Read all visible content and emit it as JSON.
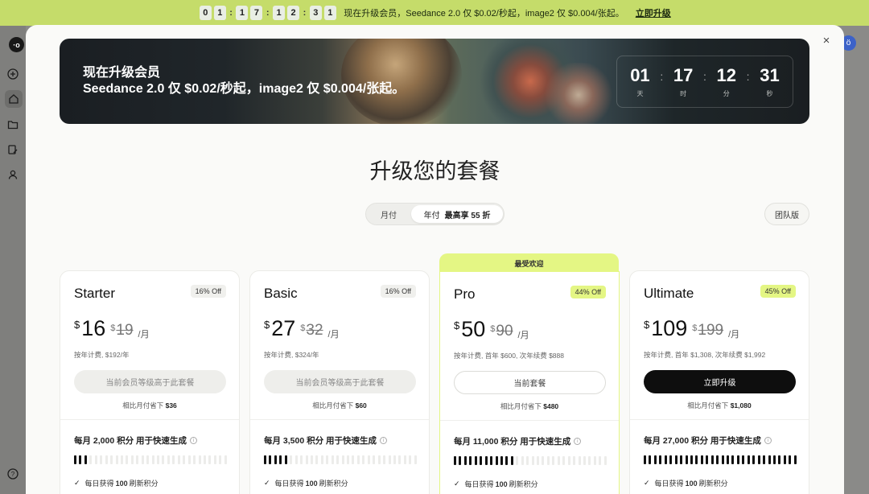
{
  "promo_bar": {
    "countdown_digits": [
      "0",
      "1",
      "1",
      "7",
      "1",
      "2",
      "3",
      "1"
    ],
    "message": "现在升级会员，Seedance 2.0 仅 $0.02/秒起，image2 仅 $0.004/张起。",
    "cta": "立即升级",
    "bg_color": "#c5dc6a"
  },
  "rail": {
    "logo": "·o",
    "icons": [
      "plus-circle-icon",
      "home-icon",
      "folder-icon",
      "edit-document-icon",
      "user-icon",
      "help-icon"
    ],
    "help_glyph": "?",
    "avatar_glyph": "ö"
  },
  "modal": {
    "close_glyph": "×",
    "banner": {
      "title": "现在升级会员",
      "subtitle": "Seedance 2.0 仅 $0.02/秒起，image2 仅 $0.004/张起。",
      "countdown": [
        {
          "value": "01",
          "label": "天"
        },
        {
          "value": "17",
          "label": "时"
        },
        {
          "value": "12",
          "label": "分"
        },
        {
          "value": "31",
          "label": "秒"
        }
      ]
    },
    "title": "升级您的套餐",
    "billing_toggle": {
      "monthly": "月付",
      "yearly": "年付",
      "yearly_discount": "最高享 55 折",
      "selected": "yearly"
    },
    "team_button": "团队版",
    "popular_tag": "最受欢迎",
    "plans": [
      {
        "name": "Starter",
        "badge": "16% Off",
        "currency": "$",
        "price": "16",
        "old_price": "19",
        "per": "/月",
        "billing_note": "按年计费, $192/年",
        "button": "当前会员等级高于此套餐",
        "button_style": "disabled",
        "savings_prefix": "相比月付省下",
        "savings": "$36",
        "credits": "每月 2,000 积分 用于快速生成",
        "credit_level": 3,
        "feature_prefix": "每日获得",
        "feature_value": "100",
        "feature_suffix": "刷新积分"
      },
      {
        "name": "Basic",
        "badge": "16% Off",
        "currency": "$",
        "price": "27",
        "old_price": "32",
        "per": "/月",
        "billing_note": "按年计费, $324/年",
        "button": "当前会员等级高于此套餐",
        "button_style": "disabled",
        "savings_prefix": "相比月付省下",
        "savings": "$60",
        "credits": "每月 3,500 积分 用于快速生成",
        "credit_level": 5,
        "feature_prefix": "每日获得",
        "feature_value": "100",
        "feature_suffix": "刷新积分"
      },
      {
        "name": "Pro",
        "badge": "44% Off",
        "currency": "$",
        "price": "50",
        "old_price": "90",
        "per": "/月",
        "billing_note": "按年计费, 首年 $600, 次年续费 $888",
        "button": "当前套餐",
        "button_style": "outline",
        "savings_prefix": "相比月付省下",
        "savings": "$480",
        "credits": "每月 11,000 积分 用于快速生成",
        "credit_level": 12,
        "feature_prefix": "每日获得",
        "feature_value": "100",
        "feature_suffix": "刷新积分"
      },
      {
        "name": "Ultimate",
        "badge": "45% Off",
        "currency": "$",
        "price": "109",
        "old_price": "199",
        "per": "/月",
        "billing_note": "按年计费, 首年 $1,308, 次年续费 $1,992",
        "button": "立即升级",
        "button_style": "primary",
        "savings_prefix": "相比月付省下",
        "savings": "$1,080",
        "credits": "每月 27,000 积分 用于快速生成",
        "credit_level": 30,
        "feature_prefix": "每日获得",
        "feature_value": "100",
        "feature_suffix": "刷新积分"
      }
    ],
    "accent_color": "#e4f684"
  }
}
